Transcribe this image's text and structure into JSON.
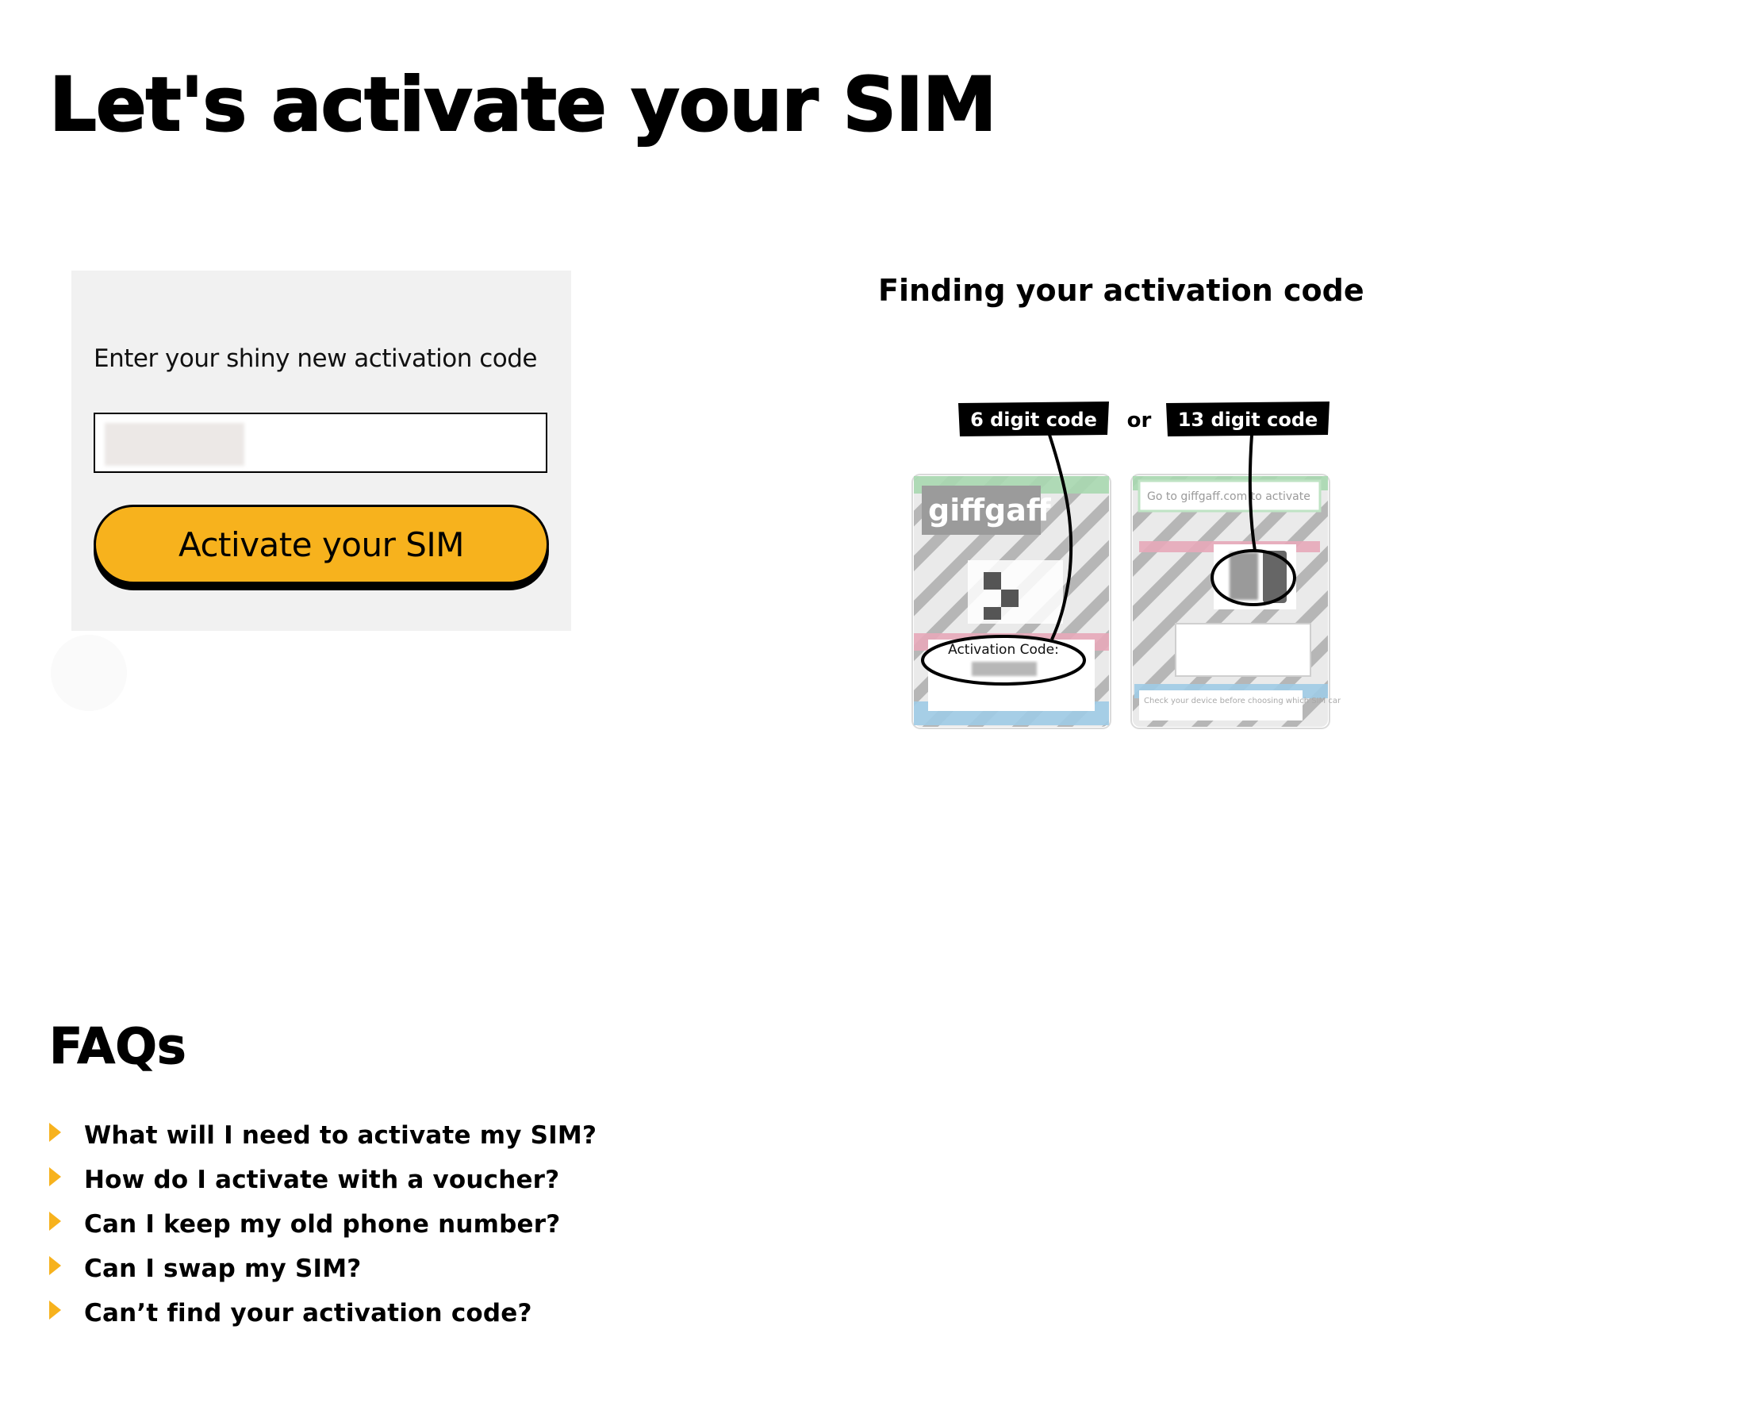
{
  "page": {
    "title": "Let's activate your SIM"
  },
  "activation": {
    "label": "Enter your shiny new activation code",
    "input_value": "",
    "button_label": "Activate your SIM"
  },
  "finding": {
    "heading": "Finding your activation code",
    "tag_six": "6 digit code",
    "or_text": "or",
    "tag_thirteen": "13 digit code",
    "card_brand": "giffgaff",
    "card_code_label": "Activation Code:",
    "card_back_text": "Go to giffgaff.com to activate",
    "card_note": "Check your device before choosing which SIM card to use."
  },
  "faqs": {
    "heading": "FAQs",
    "items": [
      {
        "question": "What will I need to activate my SIM?"
      },
      {
        "question": "How do I activate with a voucher?"
      },
      {
        "question": "Can I keep my old phone number?"
      },
      {
        "question": "Can I swap my SIM?"
      },
      {
        "question": "Can’t find your activation code?"
      }
    ]
  },
  "colors": {
    "accent": "#f7b21d",
    "panel_bg": "#f1f1f1"
  }
}
